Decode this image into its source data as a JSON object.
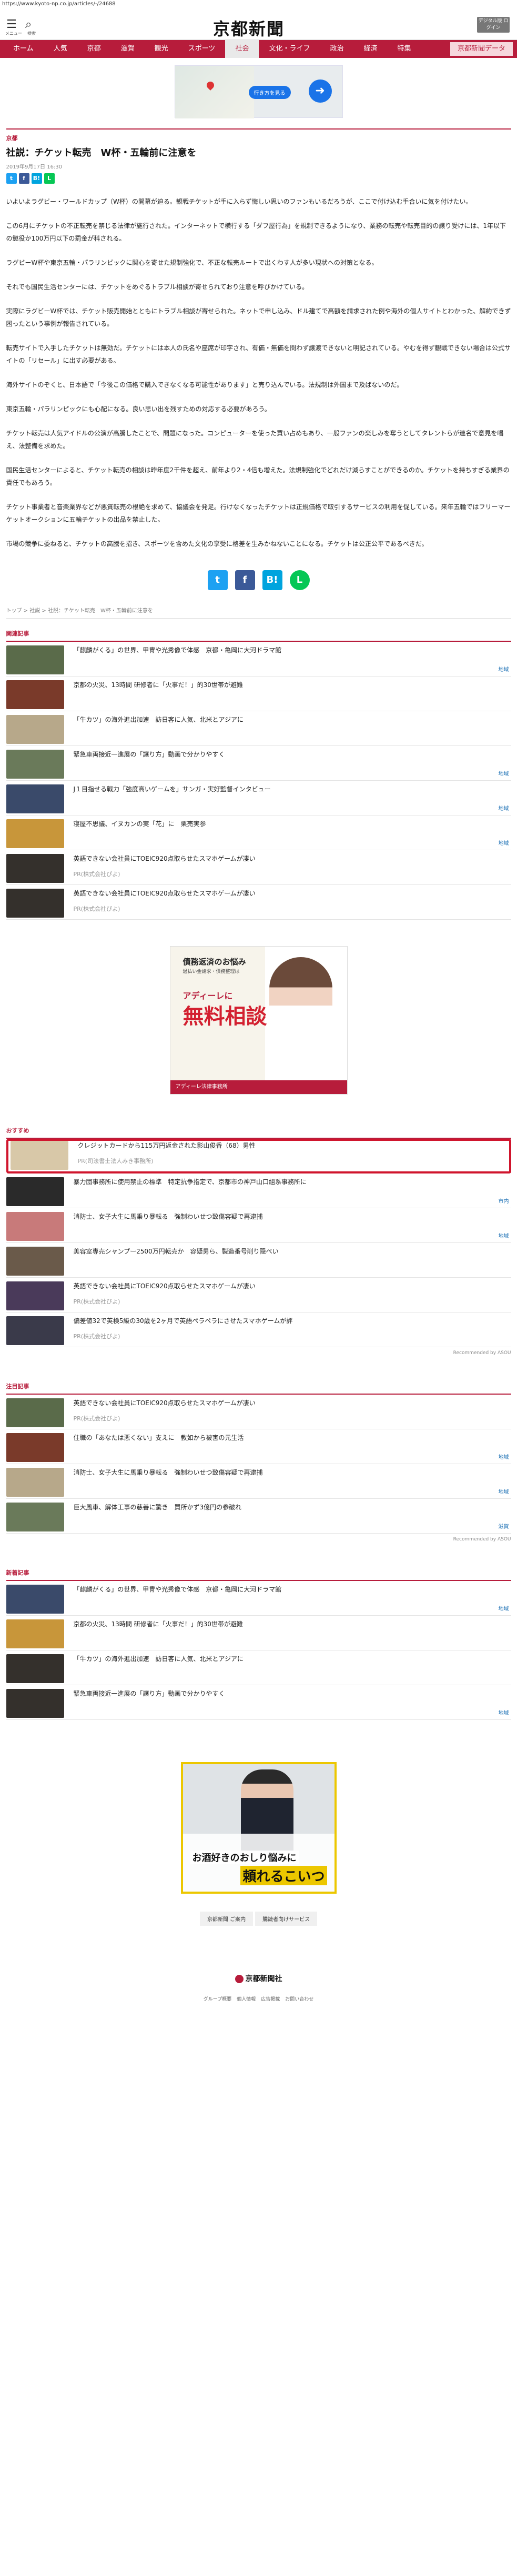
{
  "url": "https://www.kyoto-np.co.jp/articles/-/24688",
  "header": {
    "menu_label": "メニュー",
    "search_label": "検索",
    "logo": "京都新聞",
    "digital_btn": "デジタル版 ログイン"
  },
  "nav": [
    "ホーム",
    "人気",
    "京都",
    "滋賀",
    "観光",
    "スポーツ",
    "社会",
    "文化・ライフ",
    "政治",
    "経済",
    "特集",
    "京都新聞データ"
  ],
  "nav_active": "社会",
  "ad_top": {
    "cta": "行き方を見る",
    "arrow": "➜"
  },
  "article": {
    "category": "京都",
    "title": "社説：チケット転売　W杯・五輪前に注意を",
    "date": "2019年9月17日 16:30",
    "paragraphs": [
      "いよいよラグビー・ワールドカップ（W杯）の開幕が迫る。観戦チケットが手に入らず悔しい思いのファンもいるだろうが、ここで付け込む手合いに気を付けたい。",
      "この6月にチケットの不正転売を禁じる法律が施行された。インターネットで横行する「ダフ屋行為」を規制できるようになり、業務の転売や転売目的の譲り受けには、1年以下の懲役か100万円以下の罰金が科される。",
      "ラグビーW杯や東京五輪・パラリンピックに関心を寄せた規制強化で、不正な転売ルートで出くわす人が多い現状への対策となる。",
      "それでも国民生活センターには、チケットをめぐるトラブル相談が寄せられており注意を呼びかけている。",
      "実際にラグビーW杯では、チケット販売開始とともにトラブル相談が寄せられた。ネットで申し込み、ドル建てで高額を請求された例や海外の個人サイトとわかった、解約できず困ったという事例が報告されている。",
      "転売サイトで入手したチケットは無効だ。チケットには本人の氏名や座席が印字され、有価・無価を問わず譲渡できないと明記されている。やむを得ず観戦できない場合は公式サイトの「リセール」に出す必要がある。",
      "海外サイトのぞくと、日本語で「今後この価格で購入できなくなる可能性があります」と売り込んでいる。法規制は外国まで及ばないのだ。",
      "東京五輪・パラリンピックにも心配になる。良い思い出を残すための対応する必要があろう。",
      "チケット転売は人気アイドルの公演が高騰したことで、問題になった。コンピューターを使った買い占めもあり、一般ファンの楽しみを奪うとしてタレントらが連名で意見を唱え、法整備を求めた。",
      "国民生活センターによると、チケット転売の相談は昨年度2千件を超え、前年より2・4倍も増えた。法規制強化でどれだけ減らすことができるのか。チケットを持ちすぎる業界の責任でもあろう。",
      "チケット事業者と音楽業界などが悪質転売の根絶を求めて、協議会を発足。行けなくなったチケットは正規価格で取引するサービスの利用を促している。来年五輪ではフリーマーケットオークションに五輪チケットの出品を禁止した。",
      "市場の競争に委ねると、チケットの高騰を招き、スポーツを含めた文化の享受に格差を生みかねないことになる。チケットは公正公平であるべきだ。"
    ]
  },
  "share": {
    "tw": "t",
    "fb": "f",
    "hb": "B!",
    "ln": "L"
  },
  "breadcrumb": "トップ > 社説 > 社説：チケット転売　W杯・五輪前に注意を",
  "related": {
    "title": "関連記事",
    "items": [
      {
        "text": "「麒麟がくる」の世界、甲冑や光秀像で体感　京都・亀岡に大河ドラマ館",
        "tag": "地域"
      },
      {
        "text": "京都の火災、13時間  研修者に「火事だ！」的30世帯が避難",
        "tag": ""
      },
      {
        "text": "「牛カツ」の海外進出加速　訪日客に人気、北米とアジアに",
        "tag": ""
      },
      {
        "text": "緊急車両接近一進展の「譲り方」動画で分かりやすく",
        "tag": "地域"
      },
      {
        "text": "J１目指せる戦力「強度高いゲームを」サンガ・実好監督インタビュー",
        "tag": "地域"
      },
      {
        "text": "寝屋不思議、イヌカンの実「花」に　栗売実参",
        "tag": "地域"
      },
      {
        "text": "英語できない会社員にTOEIC920点取らせたスマホゲームが凄い",
        "sub": "PR(株式会社ぴよ)",
        "tag": ""
      },
      {
        "text": "英語できない会社員にTOEIC920点取らせたスマホゲームが凄い",
        "sub": "PR(株式会社ぴよ)",
        "tag": ""
      }
    ]
  },
  "ad_mid": {
    "line1": "債務返済のお悩み",
    "line2": "過払い金請求・債務整理は",
    "line3": "アディーレに",
    "line4": "無料相談",
    "footer": "アディーレ法律事務所"
  },
  "recommended": {
    "title": "おすすめ",
    "items": [
      {
        "text": "クレジットカードから115万円返金された影山俊香（68）男性",
        "sub": "PR(司法書士法人みき事務所)",
        "tag": "",
        "highlight": true
      },
      {
        "text": "暴力団事務所に使用禁止の標準　特定抗争指定で、京都市の神戸山口組系事務所に",
        "tag": "市内"
      },
      {
        "text": "消防士、女子大生に馬乗り暴転る　強制わいせつ致傷容疑で再逮捕",
        "tag": "地域"
      },
      {
        "text": "美容室専売シャンプー2500万円転売か　容疑男ら、製造番号削り隠ぺい",
        "tag": ""
      },
      {
        "text": "英語できない会社員にTOEIC920点取らせたスマホゲームが凄い",
        "sub": "PR(株式会社ぴよ)",
        "tag": ""
      },
      {
        "text": "偏差値32で英検5級の30歳を2ヶ月で英語ペラペラにさせたスマホゲームが評",
        "sub": "PR(株式会社ぴよ)",
        "tag": ""
      }
    ],
    "by": "Recommended by ɅЅOU"
  },
  "popular": {
    "title": "注目記事",
    "items": [
      {
        "text": "英語できない会社員にTOEIC920点取らせたスマホゲームが凄い",
        "sub": "PR(株式会社ぴよ)",
        "tag": ""
      },
      {
        "text": "住職の「あなたは悪くない」支えに　教如から被害の元生活",
        "tag": "地域"
      },
      {
        "text": "消防士、女子大生に馬乗り暴転る　強制わいせつ致傷容疑で再逮捕",
        "tag": "地域"
      },
      {
        "text": "巨大風車、解体工事の慈善に驚き　買所かず3億円の参破れ",
        "tag": "滋賀"
      }
    ],
    "by": "Recommended by ɅЅOU"
  },
  "latest": {
    "title": "新着記事",
    "items": [
      {
        "text": "「麒麟がくる」の世界、甲冑や光秀像で体感　京都・亀岡に大河ドラマ館",
        "tag": "地域"
      },
      {
        "text": "京都の火災、13時間  研修者に「火事だ！」的30世帯が避難",
        "tag": ""
      },
      {
        "text": "「牛カツ」の海外進出加速　訪日客に人気、北米とアジアに",
        "tag": ""
      },
      {
        "text": "緊急車両接近一進展の「譲り方」動画で分かりやすく",
        "tag": "地域"
      }
    ]
  },
  "ad_bottom": {
    "line1": "お酒好きのおしり悩みに",
    "line2": "頼れるこいつ"
  },
  "footer": {
    "links": [
      "京都新聞 ご案内",
      "購読者向けサービス"
    ],
    "logo": "京都新聞社",
    "menu": [
      "グループ概要",
      "個人情報",
      "広告掲載",
      "お問い合わせ"
    ]
  }
}
